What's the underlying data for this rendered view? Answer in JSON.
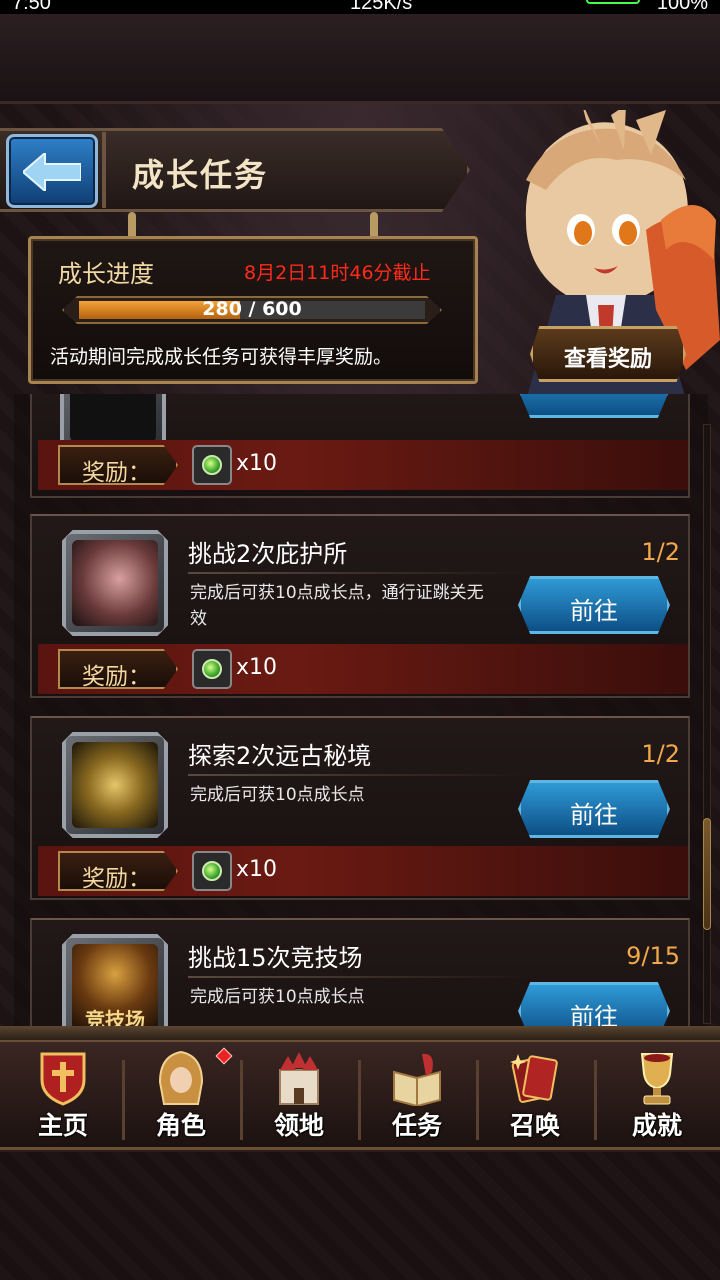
{
  "status_bar": {
    "time": "7:50",
    "net_speed": "125K/s",
    "battery": "100%"
  },
  "header": {
    "title": "成长任务"
  },
  "progress": {
    "label": "成长进度",
    "deadline": "8月2日11时46分截止",
    "current": 280,
    "total": 600,
    "text": "280 / 600",
    "fraction": 0.4667,
    "description": "活动期间完成成长任务可获得丰厚奖励。",
    "view_reward_label": "查看奖励"
  },
  "tasks": [
    {
      "title": "",
      "count": "",
      "desc": "",
      "go_label": "",
      "reward_label": "奖励：",
      "reward_qty": "x10"
    },
    {
      "title": "挑战2次庇护所",
      "count": "1/2",
      "desc": "完成后可获10点成长点，通行证跳关无效",
      "go_label": "前往",
      "reward_label": "奖励：",
      "reward_qty": "x10"
    },
    {
      "title": "探索2次远古秘境",
      "count": "1/2",
      "desc": "完成后可获10点成长点",
      "go_label": "前往",
      "reward_label": "奖励：",
      "reward_qty": "x10"
    },
    {
      "title": "挑战15次竞技场",
      "count": "9/15",
      "desc": "完成后可获10点成长点",
      "go_label": "前往",
      "icon_text": "竞技场"
    }
  ],
  "nav": [
    {
      "label": "主页",
      "icon": "shield-cross-icon"
    },
    {
      "label": "角色",
      "icon": "hooded-character-icon"
    },
    {
      "label": "领地",
      "icon": "castle-icon"
    },
    {
      "label": "任务",
      "icon": "quest-book-icon"
    },
    {
      "label": "召唤",
      "icon": "summon-cards-icon"
    },
    {
      "label": "成就",
      "icon": "trophy-icon"
    }
  ],
  "colors": {
    "accent_gold": "#f0a84a",
    "deadline_red": "#ff2a1a",
    "button_blue": "#2f9ad6"
  }
}
